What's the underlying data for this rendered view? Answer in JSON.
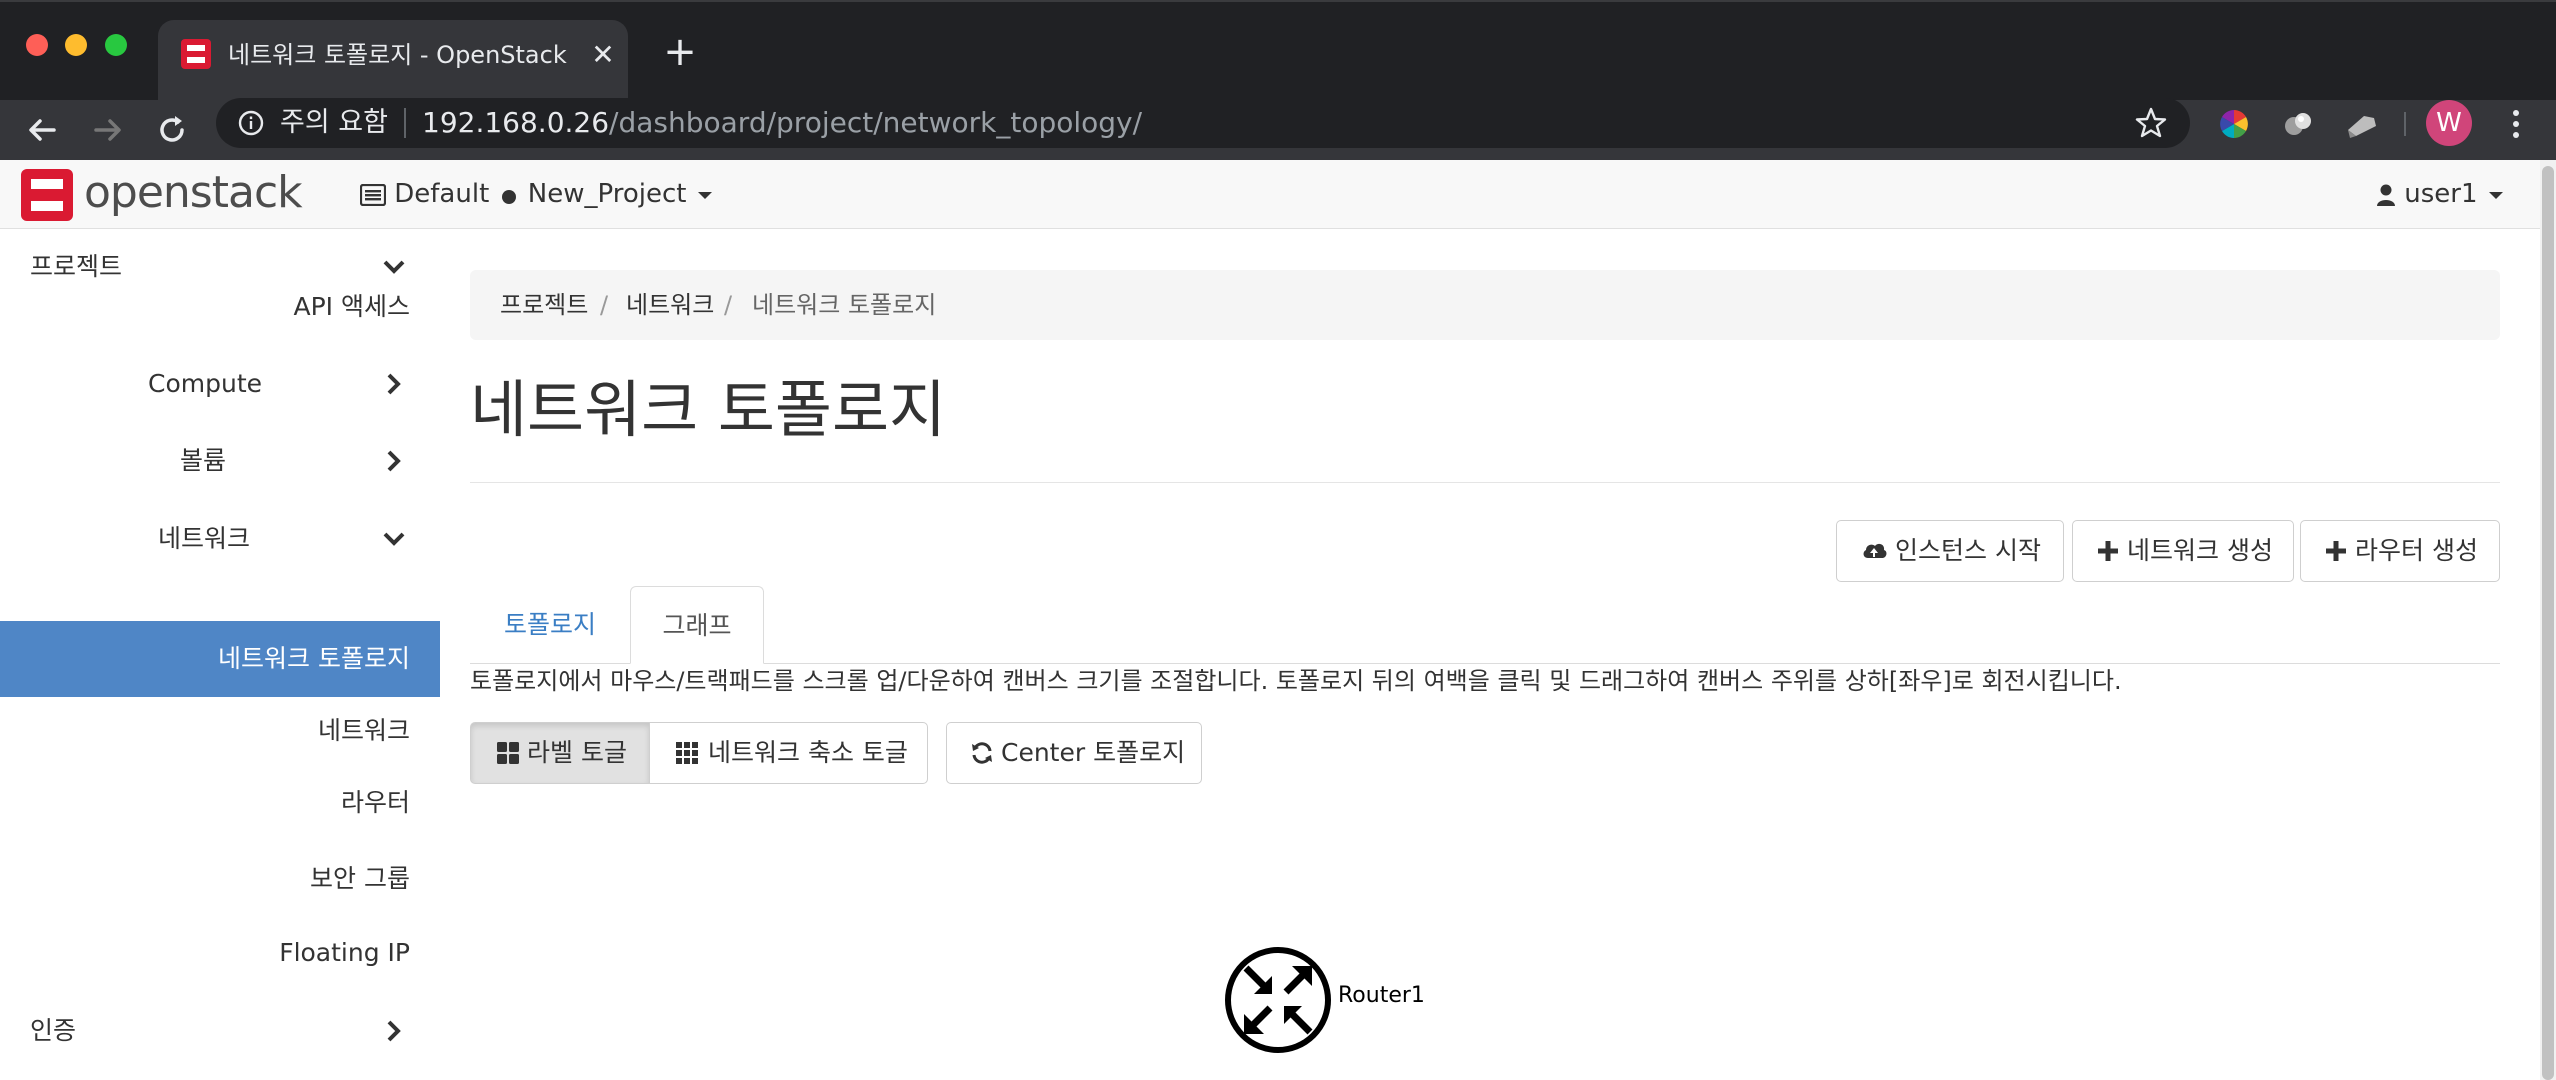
{
  "browser": {
    "tab_title": "네트워크 토폴로지 - OpenStack Da",
    "omnibox": {
      "warning": "주의 요함",
      "url_host": "192.168.0.26",
      "url_path": "/dashboard/project/network_topology/"
    },
    "profile_initial": "W"
  },
  "header": {
    "logo_text": "openstack",
    "domain": "Default",
    "project": "New_Project",
    "user": "user1"
  },
  "sidebar": {
    "items": [
      {
        "label": "프로젝트"
      },
      {
        "label": "API 액세스"
      },
      {
        "label": "Compute"
      },
      {
        "label": "볼륨"
      },
      {
        "label": "네트워크"
      },
      {
        "label": "네트워크 토폴로지"
      },
      {
        "label": "네트워크"
      },
      {
        "label": "라우터"
      },
      {
        "label": "보안 그룹"
      },
      {
        "label": "Floating IP"
      },
      {
        "label": "인증"
      }
    ]
  },
  "breadcrumb": [
    "프로젝트",
    "네트워크",
    "네트워크 토폴로지"
  ],
  "page_title": "네트워크 토폴로지",
  "actions": {
    "launch_instance": "인스턴스 시작",
    "create_network": "네트워크 생성",
    "create_router": "라우터 생성"
  },
  "tabs": {
    "topology": "토폴로지",
    "graph": "그래프"
  },
  "help_text": "토폴로지에서 마우스/트랙패드를 스크롤 업/다운하여 캔버스 크기를 조절합니다. 토폴로지 뒤의 여백을 클릭 및 드래그하여 캔버스 주위를 상하[좌우]로 회전시킵니다.",
  "controls": {
    "toggle_labels": "라벨 토글",
    "toggle_network_collapse": "네트워크 축소 토글",
    "center_topology": "Center 토폴로지"
  },
  "graph": {
    "router_label": "Router1"
  },
  "colors": {
    "active_sidebar": "#4f86c6",
    "link": "#3a7ec4",
    "brand_red": "#da1a32"
  }
}
